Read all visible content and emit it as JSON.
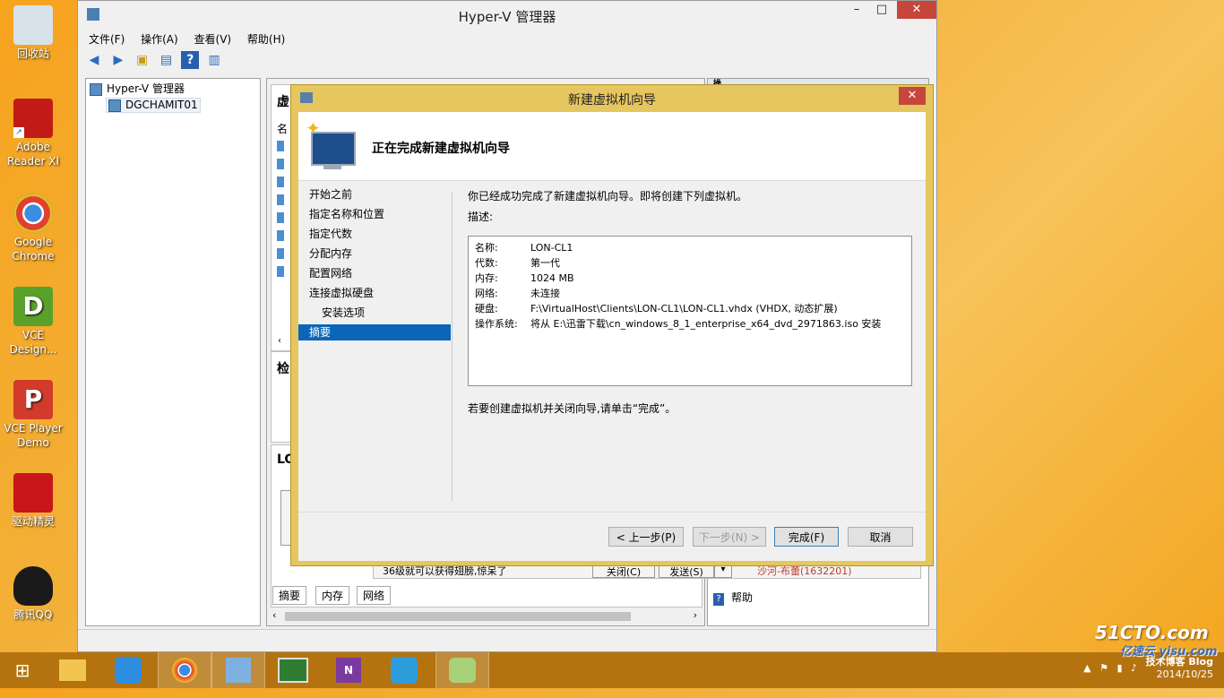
{
  "desktop": {
    "icons": [
      {
        "label": "回收站",
        "color": "#d8e2ea"
      },
      {
        "label": "Adobe Reader XI",
        "color": "#c21b17"
      },
      {
        "label": "Google Chrome",
        "color": "#3a8de0"
      },
      {
        "label": "VCE Design...",
        "color": "#5aa12b"
      },
      {
        "label": "VCE Player Demo",
        "color": "#d23a2b"
      },
      {
        "label": "驱动精灵",
        "color": "#c8161b"
      },
      {
        "label": "腾讯QQ",
        "color": "#1a1a1a"
      }
    ]
  },
  "hyperv": {
    "title": "Hyper-V 管理器",
    "menu": [
      "文件(F)",
      "操作(A)",
      "查看(V)",
      "帮助(H)"
    ],
    "tree_root": "Hyper-V 管理器",
    "tree_child": "DGCHAMIT01",
    "center_header_vm": "虚",
    "center_col_name": "名",
    "checkpoint_header": "检",
    "details_header": "LO",
    "bottom_tabs": [
      "摘要",
      "内存",
      "网络"
    ],
    "actions_header": "操",
    "help_label": "帮助"
  },
  "wizard": {
    "title": "新建虚拟机向导",
    "heading": "正在完成新建虚拟机向导",
    "nav": [
      "开始之前",
      "指定名称和位置",
      "指定代数",
      "分配内存",
      "配置网络",
      "连接虚拟硬盘",
      "安装选项",
      "摘要"
    ],
    "intro": "你已经成功完成了新建虚拟机向导。即将创建下列虚拟机。",
    "desc_label": "描述:",
    "summary": [
      {
        "k": "名称:",
        "v": "LON-CL1"
      },
      {
        "k": "代数:",
        "v": "第一代"
      },
      {
        "k": "内存:",
        "v": "1024 MB"
      },
      {
        "k": "网络:",
        "v": "未连接"
      },
      {
        "k": "硬盘:",
        "v": "F:\\VirtualHost\\Clients\\LON-CL1\\LON-CL1.vhdx (VHDX, 动态扩展)"
      },
      {
        "k": "操作系统:",
        "v": "将从 E:\\迅雷下载\\cn_windows_8_1_enterprise_x64_dvd_2971863.iso 安装"
      }
    ],
    "finish_hint": "若要创建虚拟机并关闭向导,请单击“完成”。",
    "buttons": {
      "prev": "< 上一步(P)",
      "next": "下一步(N) >",
      "finish": "完成(F)",
      "cancel": "取消"
    }
  },
  "background_chat": {
    "text": "36级就可以获得翅膀,惊呆了",
    "close": "关闭(C)",
    "send": "发送(S)",
    "contact": "沙河-布蕾(1632201)"
  },
  "taskbar": {
    "date": "2014/10/25",
    "watermark": "51CTO.com",
    "watermark2": "技术博客 Blog",
    "watermark3": "亿速云 yisu.com"
  }
}
